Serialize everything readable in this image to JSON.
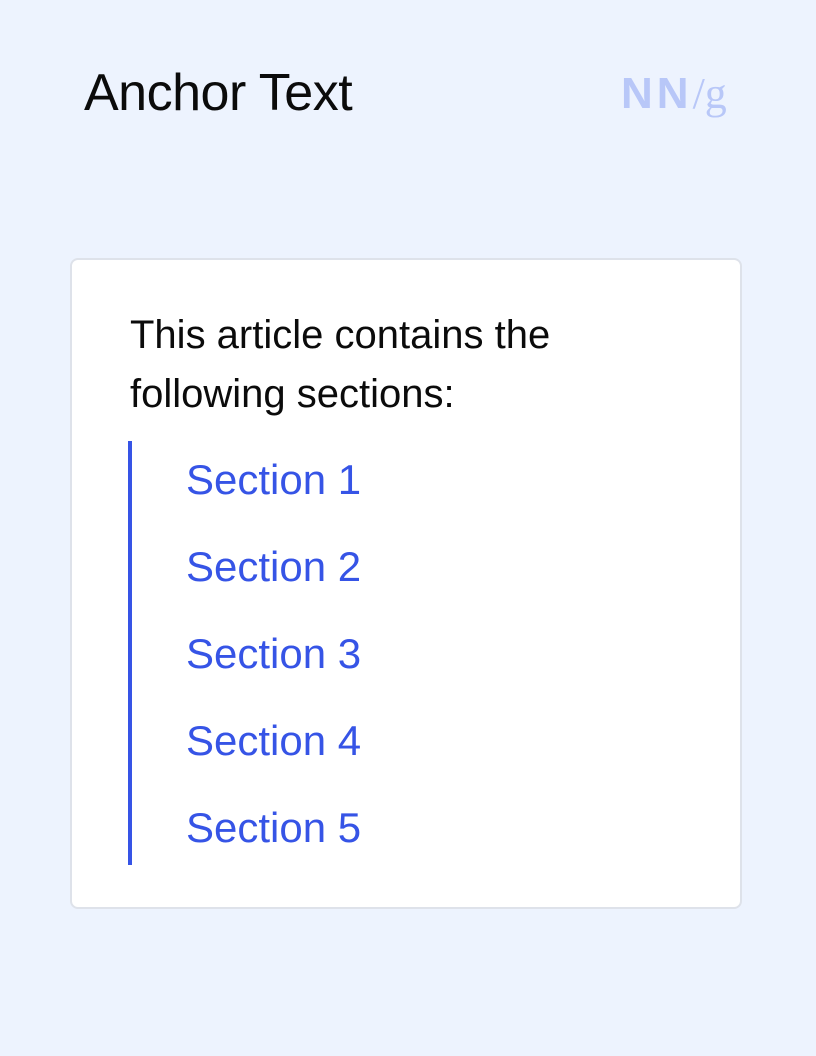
{
  "header": {
    "title": "Anchor Text",
    "logo": {
      "nn": "NN",
      "slash": "/",
      "g": "g"
    }
  },
  "card": {
    "intro": "This article contains the following sections:",
    "sections": [
      "Section 1",
      "Section 2",
      "Section 3",
      "Section 4",
      "Section 5"
    ]
  },
  "colors": {
    "background": "#edf3fe",
    "link": "#3654e6",
    "logo": "#b8c7f8",
    "text": "#0b0b0b"
  }
}
